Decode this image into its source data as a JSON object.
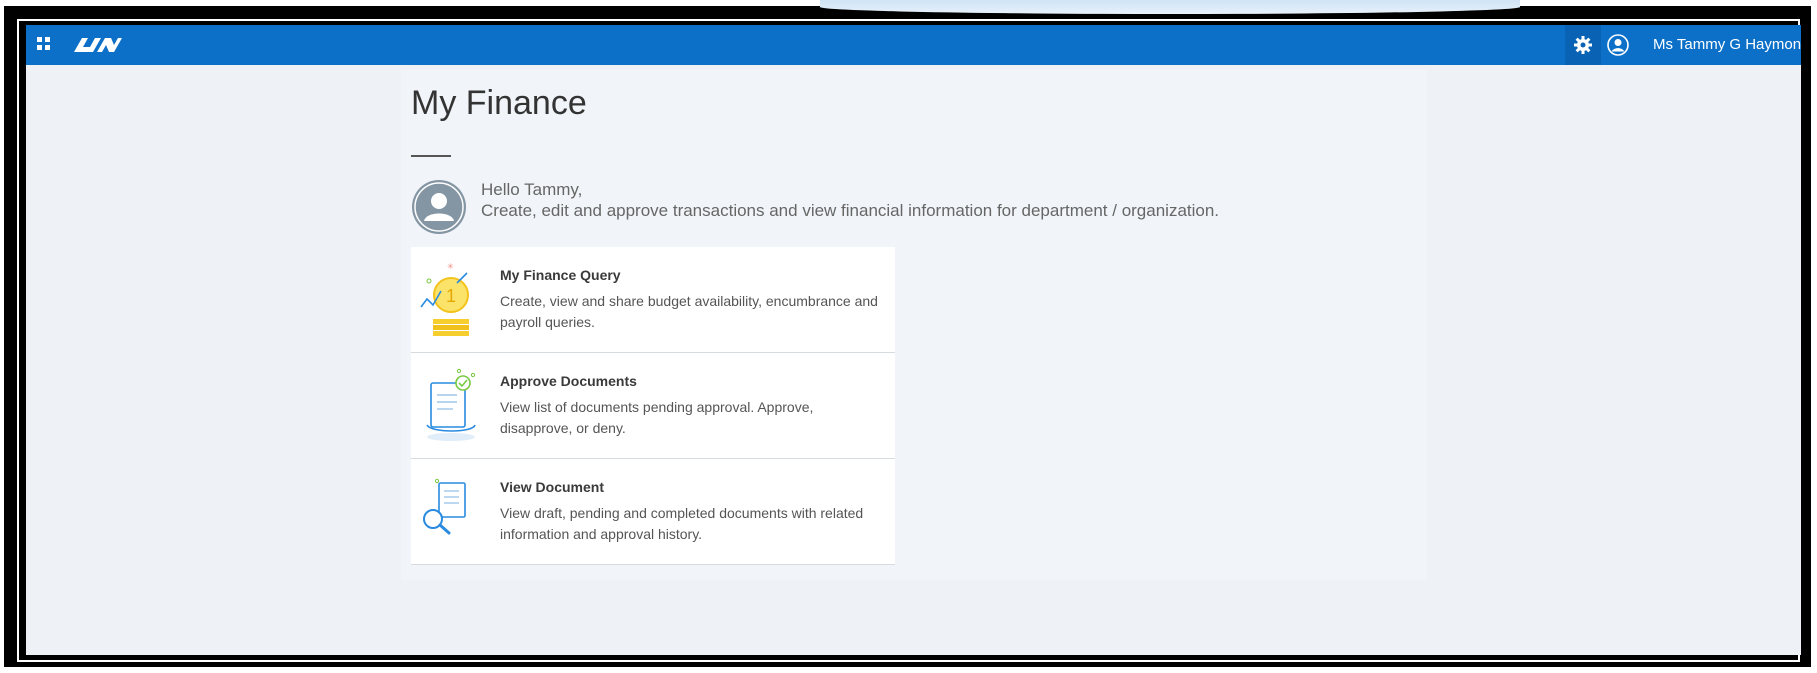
{
  "header": {
    "user_name": "Ms Tammy G Haymon",
    "colors": {
      "bar": "#0c70c8",
      "gear_bg": "#0a62b4"
    },
    "icons": [
      "grid-icon",
      "uah-logo",
      "gear-icon",
      "user-icon"
    ]
  },
  "main": {
    "title": "My Finance",
    "greeting": "Hello Tammy,",
    "subtitle": "Create, edit and approve transactions and view financial information for department / organization.",
    "cards": [
      {
        "title": "My Finance Query",
        "description": "Create, view and share budget availability, encumbrance and payroll queries.",
        "icon": "finance-query-icon"
      },
      {
        "title": "Approve Documents",
        "description": "View list of documents pending approval. Approve, disapprove, or deny.",
        "icon": "approve-documents-icon"
      },
      {
        "title": "View Document",
        "description": "View draft, pending and completed documents with related information and approval history.",
        "icon": "view-document-icon"
      }
    ]
  }
}
